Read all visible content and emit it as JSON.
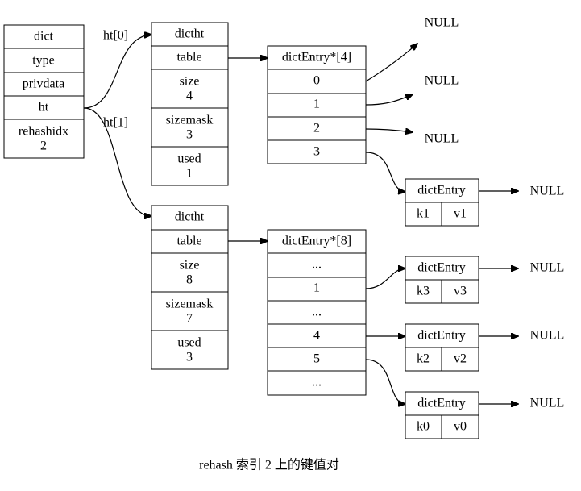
{
  "diagram": {
    "caption": "rehash 索引 2 上的键值对",
    "dict": {
      "fields": [
        "dict",
        "type",
        "privdata",
        "ht",
        [
          "rehashidx",
          "2"
        ]
      ]
    },
    "ht_labels": [
      "ht[0]",
      "ht[1]"
    ],
    "dictht0": {
      "fields": [
        "dictht",
        "table",
        [
          "size",
          "4"
        ],
        [
          "sizemask",
          "3"
        ],
        [
          "used",
          "1"
        ]
      ]
    },
    "dictht1": {
      "fields": [
        "dictht",
        "table",
        [
          "size",
          "8"
        ],
        [
          "sizemask",
          "7"
        ],
        [
          "used",
          "3"
        ]
      ]
    },
    "table0": {
      "fields": [
        "dictEntry*[4]",
        "0",
        "1",
        "2",
        "3"
      ]
    },
    "table1": {
      "fields": [
        "dictEntry*[8]",
        "...",
        "1",
        "...",
        "4",
        "5",
        "..."
      ]
    },
    "null_label": "NULL",
    "entries": [
      {
        "title": "dictEntry",
        "key": "k1",
        "value": "v1",
        "bucket": "table0[3]"
      },
      {
        "title": "dictEntry",
        "key": "k3",
        "value": "v3",
        "bucket": "table1[1]"
      },
      {
        "title": "dictEntry",
        "key": "k2",
        "value": "v2",
        "bucket": "table1[4]"
      },
      {
        "title": "dictEntry",
        "key": "k0",
        "value": "v0",
        "bucket": "table1[5]"
      }
    ]
  }
}
